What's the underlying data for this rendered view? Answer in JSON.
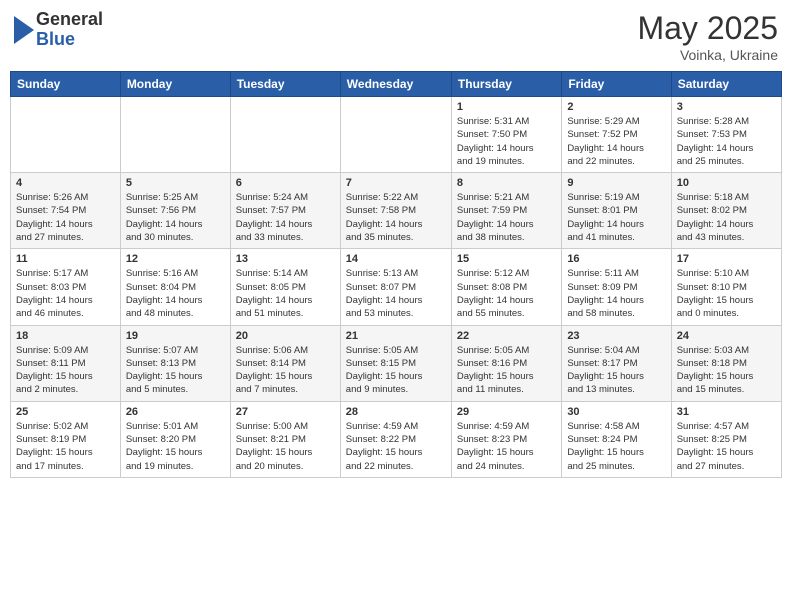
{
  "header": {
    "logo_general": "General",
    "logo_blue": "Blue",
    "title_month": "May 2025",
    "title_location": "Voinka, Ukraine"
  },
  "days_of_week": [
    "Sunday",
    "Monday",
    "Tuesday",
    "Wednesday",
    "Thursday",
    "Friday",
    "Saturday"
  ],
  "weeks": [
    [
      {
        "day": "",
        "info": ""
      },
      {
        "day": "",
        "info": ""
      },
      {
        "day": "",
        "info": ""
      },
      {
        "day": "",
        "info": ""
      },
      {
        "day": "1",
        "info": "Sunrise: 5:31 AM\nSunset: 7:50 PM\nDaylight: 14 hours\nand 19 minutes."
      },
      {
        "day": "2",
        "info": "Sunrise: 5:29 AM\nSunset: 7:52 PM\nDaylight: 14 hours\nand 22 minutes."
      },
      {
        "day": "3",
        "info": "Sunrise: 5:28 AM\nSunset: 7:53 PM\nDaylight: 14 hours\nand 25 minutes."
      }
    ],
    [
      {
        "day": "4",
        "info": "Sunrise: 5:26 AM\nSunset: 7:54 PM\nDaylight: 14 hours\nand 27 minutes."
      },
      {
        "day": "5",
        "info": "Sunrise: 5:25 AM\nSunset: 7:56 PM\nDaylight: 14 hours\nand 30 minutes."
      },
      {
        "day": "6",
        "info": "Sunrise: 5:24 AM\nSunset: 7:57 PM\nDaylight: 14 hours\nand 33 minutes."
      },
      {
        "day": "7",
        "info": "Sunrise: 5:22 AM\nSunset: 7:58 PM\nDaylight: 14 hours\nand 35 minutes."
      },
      {
        "day": "8",
        "info": "Sunrise: 5:21 AM\nSunset: 7:59 PM\nDaylight: 14 hours\nand 38 minutes."
      },
      {
        "day": "9",
        "info": "Sunrise: 5:19 AM\nSunset: 8:01 PM\nDaylight: 14 hours\nand 41 minutes."
      },
      {
        "day": "10",
        "info": "Sunrise: 5:18 AM\nSunset: 8:02 PM\nDaylight: 14 hours\nand 43 minutes."
      }
    ],
    [
      {
        "day": "11",
        "info": "Sunrise: 5:17 AM\nSunset: 8:03 PM\nDaylight: 14 hours\nand 46 minutes."
      },
      {
        "day": "12",
        "info": "Sunrise: 5:16 AM\nSunset: 8:04 PM\nDaylight: 14 hours\nand 48 minutes."
      },
      {
        "day": "13",
        "info": "Sunrise: 5:14 AM\nSunset: 8:05 PM\nDaylight: 14 hours\nand 51 minutes."
      },
      {
        "day": "14",
        "info": "Sunrise: 5:13 AM\nSunset: 8:07 PM\nDaylight: 14 hours\nand 53 minutes."
      },
      {
        "day": "15",
        "info": "Sunrise: 5:12 AM\nSunset: 8:08 PM\nDaylight: 14 hours\nand 55 minutes."
      },
      {
        "day": "16",
        "info": "Sunrise: 5:11 AM\nSunset: 8:09 PM\nDaylight: 14 hours\nand 58 minutes."
      },
      {
        "day": "17",
        "info": "Sunrise: 5:10 AM\nSunset: 8:10 PM\nDaylight: 15 hours\nand 0 minutes."
      }
    ],
    [
      {
        "day": "18",
        "info": "Sunrise: 5:09 AM\nSunset: 8:11 PM\nDaylight: 15 hours\nand 2 minutes."
      },
      {
        "day": "19",
        "info": "Sunrise: 5:07 AM\nSunset: 8:13 PM\nDaylight: 15 hours\nand 5 minutes."
      },
      {
        "day": "20",
        "info": "Sunrise: 5:06 AM\nSunset: 8:14 PM\nDaylight: 15 hours\nand 7 minutes."
      },
      {
        "day": "21",
        "info": "Sunrise: 5:05 AM\nSunset: 8:15 PM\nDaylight: 15 hours\nand 9 minutes."
      },
      {
        "day": "22",
        "info": "Sunrise: 5:05 AM\nSunset: 8:16 PM\nDaylight: 15 hours\nand 11 minutes."
      },
      {
        "day": "23",
        "info": "Sunrise: 5:04 AM\nSunset: 8:17 PM\nDaylight: 15 hours\nand 13 minutes."
      },
      {
        "day": "24",
        "info": "Sunrise: 5:03 AM\nSunset: 8:18 PM\nDaylight: 15 hours\nand 15 minutes."
      }
    ],
    [
      {
        "day": "25",
        "info": "Sunrise: 5:02 AM\nSunset: 8:19 PM\nDaylight: 15 hours\nand 17 minutes."
      },
      {
        "day": "26",
        "info": "Sunrise: 5:01 AM\nSunset: 8:20 PM\nDaylight: 15 hours\nand 19 minutes."
      },
      {
        "day": "27",
        "info": "Sunrise: 5:00 AM\nSunset: 8:21 PM\nDaylight: 15 hours\nand 20 minutes."
      },
      {
        "day": "28",
        "info": "Sunrise: 4:59 AM\nSunset: 8:22 PM\nDaylight: 15 hours\nand 22 minutes."
      },
      {
        "day": "29",
        "info": "Sunrise: 4:59 AM\nSunset: 8:23 PM\nDaylight: 15 hours\nand 24 minutes."
      },
      {
        "day": "30",
        "info": "Sunrise: 4:58 AM\nSunset: 8:24 PM\nDaylight: 15 hours\nand 25 minutes."
      },
      {
        "day": "31",
        "info": "Sunrise: 4:57 AM\nSunset: 8:25 PM\nDaylight: 15 hours\nand 27 minutes."
      }
    ]
  ]
}
